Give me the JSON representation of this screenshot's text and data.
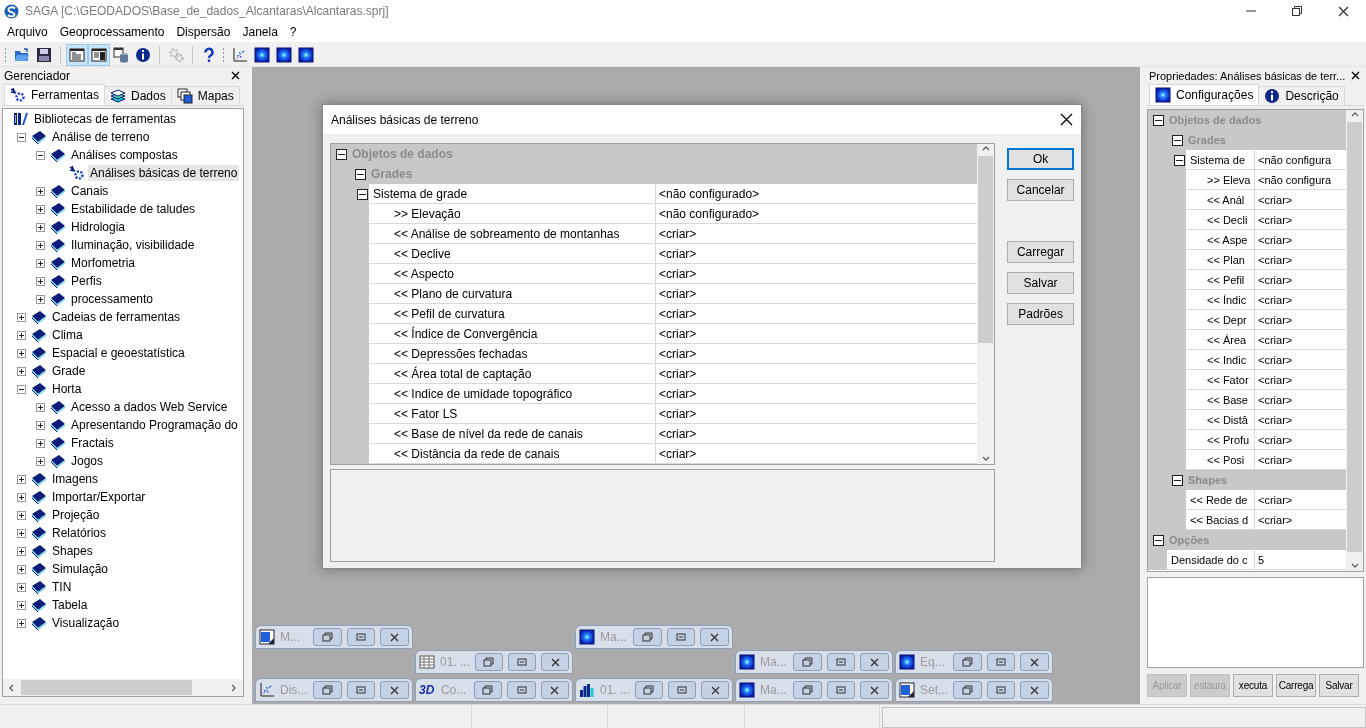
{
  "window": {
    "title": "SAGA [C:\\GEODADOS\\Base_de_dados_Alcantaras\\Alcantaras.sprj]"
  },
  "menu": [
    "Arquivo",
    "Geoprocessamento",
    "Dispersão",
    "Janela",
    "?"
  ],
  "toolbar": [
    {
      "gripper": true,
      "items": [
        {
          "kind": "open",
          "pressed": false,
          "disabled": false
        },
        {
          "kind": "save",
          "pressed": false,
          "disabled": false
        }
      ]
    },
    {
      "gripper": false,
      "items": [
        {
          "kind": "tree",
          "pressed": true,
          "disabled": false
        },
        {
          "kind": "list",
          "pressed": true,
          "disabled": false
        },
        {
          "kind": "data",
          "pressed": false,
          "disabled": false
        },
        {
          "kind": "info",
          "pressed": false,
          "disabled": false
        }
      ]
    },
    {
      "gripper": false,
      "items": [
        {
          "kind": "gear",
          "pressed": false,
          "disabled": true
        }
      ]
    },
    {
      "gripper": false,
      "items": [
        {
          "kind": "help",
          "pressed": false,
          "disabled": false
        }
      ]
    },
    {
      "gripper": true,
      "items": [
        {
          "kind": "scatter",
          "pressed": false,
          "disabled": false
        },
        {
          "kind": "map",
          "pressed": false,
          "disabled": false
        },
        {
          "kind": "map",
          "pressed": false,
          "disabled": false
        },
        {
          "kind": "map",
          "pressed": false,
          "disabled": false
        }
      ]
    }
  ],
  "manager": {
    "title": "Gerenciador",
    "tabs": [
      {
        "label": "Ferramentas",
        "kind": "tools",
        "selected": true
      },
      {
        "label": "Dados",
        "kind": "data",
        "selected": false
      },
      {
        "label": "Mapas",
        "kind": "maps",
        "selected": false
      }
    ],
    "tree": {
      "label": "Bibliotecas de ferramentas",
      "kind": "root",
      "selected": false,
      "children": [
        {
          "label": "Análise de terreno",
          "kind": "library",
          "selected": false,
          "expanded": true,
          "children": [
            {
              "label": "Análises compostas",
              "kind": "library",
              "selected": false,
              "expanded": true,
              "children": [
                {
                  "label": "Análises básicas de terreno",
                  "kind": "tool",
                  "selected": true
                }
              ]
            },
            {
              "label": "Canais",
              "kind": "library",
              "selected": false,
              "expanded": false
            },
            {
              "label": "Estabilidade de taludes",
              "kind": "library",
              "selected": false,
              "expanded": false
            },
            {
              "label": "Hidrologia",
              "kind": "library",
              "selected": false,
              "expanded": false
            },
            {
              "label": "Iluminação, visibilidade",
              "kind": "library",
              "selected": false,
              "expanded": false
            },
            {
              "label": "Morfometria",
              "kind": "library",
              "selected": false,
              "expanded": false
            },
            {
              "label": "Perfis",
              "kind": "library",
              "selected": false,
              "expanded": false
            },
            {
              "label": "processamento",
              "kind": "library",
              "selected": false,
              "expanded": false
            }
          ]
        },
        {
          "label": "Cadeias de ferramentas",
          "kind": "library",
          "selected": false,
          "expanded": false
        },
        {
          "label": "Clima",
          "kind": "library",
          "selected": false,
          "expanded": false
        },
        {
          "label": "Espacial e geoestatística",
          "kind": "library",
          "selected": false,
          "expanded": false
        },
        {
          "label": "Grade",
          "kind": "library",
          "selected": false,
          "expanded": false
        },
        {
          "label": "Horta",
          "kind": "library",
          "selected": false,
          "expanded": true,
          "children": [
            {
              "label": "Acesso a dados Web Service",
              "kind": "library",
              "selected": false,
              "expanded": false
            },
            {
              "label": "Apresentando Programação do",
              "kind": "library",
              "selected": false,
              "expanded": false
            },
            {
              "label": "Fractais",
              "kind": "library",
              "selected": false,
              "expanded": false
            },
            {
              "label": "Jogos",
              "kind": "library",
              "selected": false,
              "expanded": false
            }
          ]
        },
        {
          "label": "Imagens",
          "kind": "library",
          "selected": false,
          "expanded": false
        },
        {
          "label": "Importar/Exportar",
          "kind": "library",
          "selected": false,
          "expanded": false
        },
        {
          "label": "Projeção",
          "kind": "library",
          "selected": false,
          "expanded": false
        },
        {
          "label": "Relatórios",
          "kind": "library",
          "selected": false,
          "expanded": false
        },
        {
          "label": "Shapes",
          "kind": "library",
          "selected": false,
          "expanded": false
        },
        {
          "label": "Simulação",
          "kind": "library",
          "selected": false,
          "expanded": false
        },
        {
          "label": "TIN",
          "kind": "library",
          "selected": false,
          "expanded": false
        },
        {
          "label": "Tabela",
          "kind": "library",
          "selected": false,
          "expanded": false
        },
        {
          "label": "Visualização",
          "kind": "library",
          "selected": false,
          "expanded": false
        }
      ]
    }
  },
  "dialog": {
    "title": "Análises básicas de terreno",
    "grid": [
      {
        "kind": "category",
        "label": "Objetos de dados",
        "expanded": true,
        "children": [
          {
            "kind": "category",
            "label": "Grades",
            "expanded": true,
            "children": [
              {
                "kind": "property",
                "name": "Sistema de grade",
                "value": "<não configurado>",
                "expanded": true,
                "children": [
                  {
                    "kind": "property",
                    "name": ">> Elevação",
                    "value": "<não configurado>"
                  },
                  {
                    "kind": "property",
                    "name": "<< Análise de sobreamento de montanhas",
                    "value": "<criar>"
                  },
                  {
                    "kind": "property",
                    "name": "<< Declive",
                    "value": "<criar>"
                  },
                  {
                    "kind": "property",
                    "name": "<< Aspecto",
                    "value": "<criar>"
                  },
                  {
                    "kind": "property",
                    "name": "<< Plano de curvatura",
                    "value": "<criar>"
                  },
                  {
                    "kind": "property",
                    "name": "<< Pefil de curvatura",
                    "value": "<criar>"
                  },
                  {
                    "kind": "property",
                    "name": "<< Índice de Convergência",
                    "value": "<criar>"
                  },
                  {
                    "kind": "property",
                    "name": "<< Depressões fechadas",
                    "value": "<criar>"
                  },
                  {
                    "kind": "property",
                    "name": "<< Área total de captação",
                    "value": "<criar>"
                  },
                  {
                    "kind": "property",
                    "name": "<< Indice de umidade topográfico",
                    "value": "<criar>"
                  },
                  {
                    "kind": "property",
                    "name": "<< Fator LS",
                    "value": "<criar>"
                  },
                  {
                    "kind": "property",
                    "name": "<< Base de nível da rede de canais",
                    "value": "<criar>"
                  },
                  {
                    "kind": "property",
                    "name": "<< Distância da rede de canais",
                    "value": "<criar>"
                  }
                ]
              }
            ]
          }
        ]
      }
    ],
    "buttons": [
      {
        "label": "Ok",
        "default": true
      },
      {
        "label": "Cancelar",
        "default": false
      },
      {
        "label": "Carregar",
        "default": false
      },
      {
        "label": "Salvar",
        "default": false
      },
      {
        "label": "Padrões",
        "default": false
      }
    ]
  },
  "minimized_windows": [
    {
      "title": "M...",
      "kind": "layout"
    },
    {
      "title": "Ma...",
      "kind": "map"
    },
    {
      "title": "01. ...",
      "kind": "table"
    },
    {
      "title": "Ma...",
      "kind": "map"
    },
    {
      "title": "Eq...",
      "kind": "map"
    },
    {
      "title": "Dis...",
      "kind": "scatter"
    },
    {
      "title": "Co...",
      "kind": "scene",
      "icon_label": "3D"
    },
    {
      "title": "01. ...",
      "kind": "histogram"
    },
    {
      "title": "Ma...",
      "kind": "map"
    },
    {
      "title": "Set...",
      "kind": "layout"
    }
  ],
  "properties": {
    "title": "Propriedades: Análises básicas de terr...",
    "tabs": [
      {
        "label": "Configurações",
        "kind": "settings",
        "selected": true
      },
      {
        "label": "Descrição",
        "kind": "info",
        "selected": false
      }
    ],
    "grid": [
      {
        "kind": "category",
        "label": "Objetos de dados",
        "expanded": true,
        "children": [
          {
            "kind": "category",
            "label": "Grades",
            "expanded": true,
            "children": [
              {
                "kind": "property",
                "name": "Sistema de",
                "value": "<não configura",
                "expanded": true,
                "children": [
                  {
                    "kind": "property",
                    "name": ">> Eleva",
                    "value": "<não configura"
                  },
                  {
                    "kind": "property",
                    "name": "<< Anál",
                    "value": "<criar>"
                  },
                  {
                    "kind": "property",
                    "name": "<< Decli",
                    "value": "<criar>"
                  },
                  {
                    "kind": "property",
                    "name": "<< Aspe",
                    "value": "<criar>"
                  },
                  {
                    "kind": "property",
                    "name": "<< Plan",
                    "value": "<criar>"
                  },
                  {
                    "kind": "property",
                    "name": "<< Pefil",
                    "value": "<criar>"
                  },
                  {
                    "kind": "property",
                    "name": "<< Índic",
                    "value": "<criar>"
                  },
                  {
                    "kind": "property",
                    "name": "<< Depr",
                    "value": "<criar>"
                  },
                  {
                    "kind": "property",
                    "name": "<< Área",
                    "value": "<criar>"
                  },
                  {
                    "kind": "property",
                    "name": "<< Indic",
                    "value": "<criar>"
                  },
                  {
                    "kind": "property",
                    "name": "<< Fator",
                    "value": "<criar>"
                  },
                  {
                    "kind": "property",
                    "name": "<< Base",
                    "value": "<criar>"
                  },
                  {
                    "kind": "property",
                    "name": "<< Distâ",
                    "value": "<criar>"
                  },
                  {
                    "kind": "property",
                    "name": "<< Profu",
                    "value": "<criar>"
                  },
                  {
                    "kind": "property",
                    "name": "<< Posi",
                    "value": "<criar>"
                  }
                ]
              }
            ]
          },
          {
            "kind": "category",
            "label": "Shapes",
            "expanded": true,
            "children": [
              {
                "kind": "property",
                "name": "<< Rede de",
                "value": "<criar>"
              },
              {
                "kind": "property",
                "name": "<< Bacias d",
                "value": "<criar>"
              }
            ]
          }
        ]
      },
      {
        "kind": "category",
        "label": "Opções",
        "expanded": true,
        "children": [
          {
            "kind": "property",
            "name": "Densidade do c",
            "value": "5"
          }
        ]
      }
    ],
    "buttons": [
      {
        "label": "Aplicar",
        "disabled": true
      },
      {
        "label": "estaura",
        "disabled": true
      },
      {
        "label": "xecuta",
        "disabled": false
      },
      {
        "label": "Carrega",
        "disabled": false
      },
      {
        "label": "Salvar",
        "disabled": false
      }
    ]
  }
}
